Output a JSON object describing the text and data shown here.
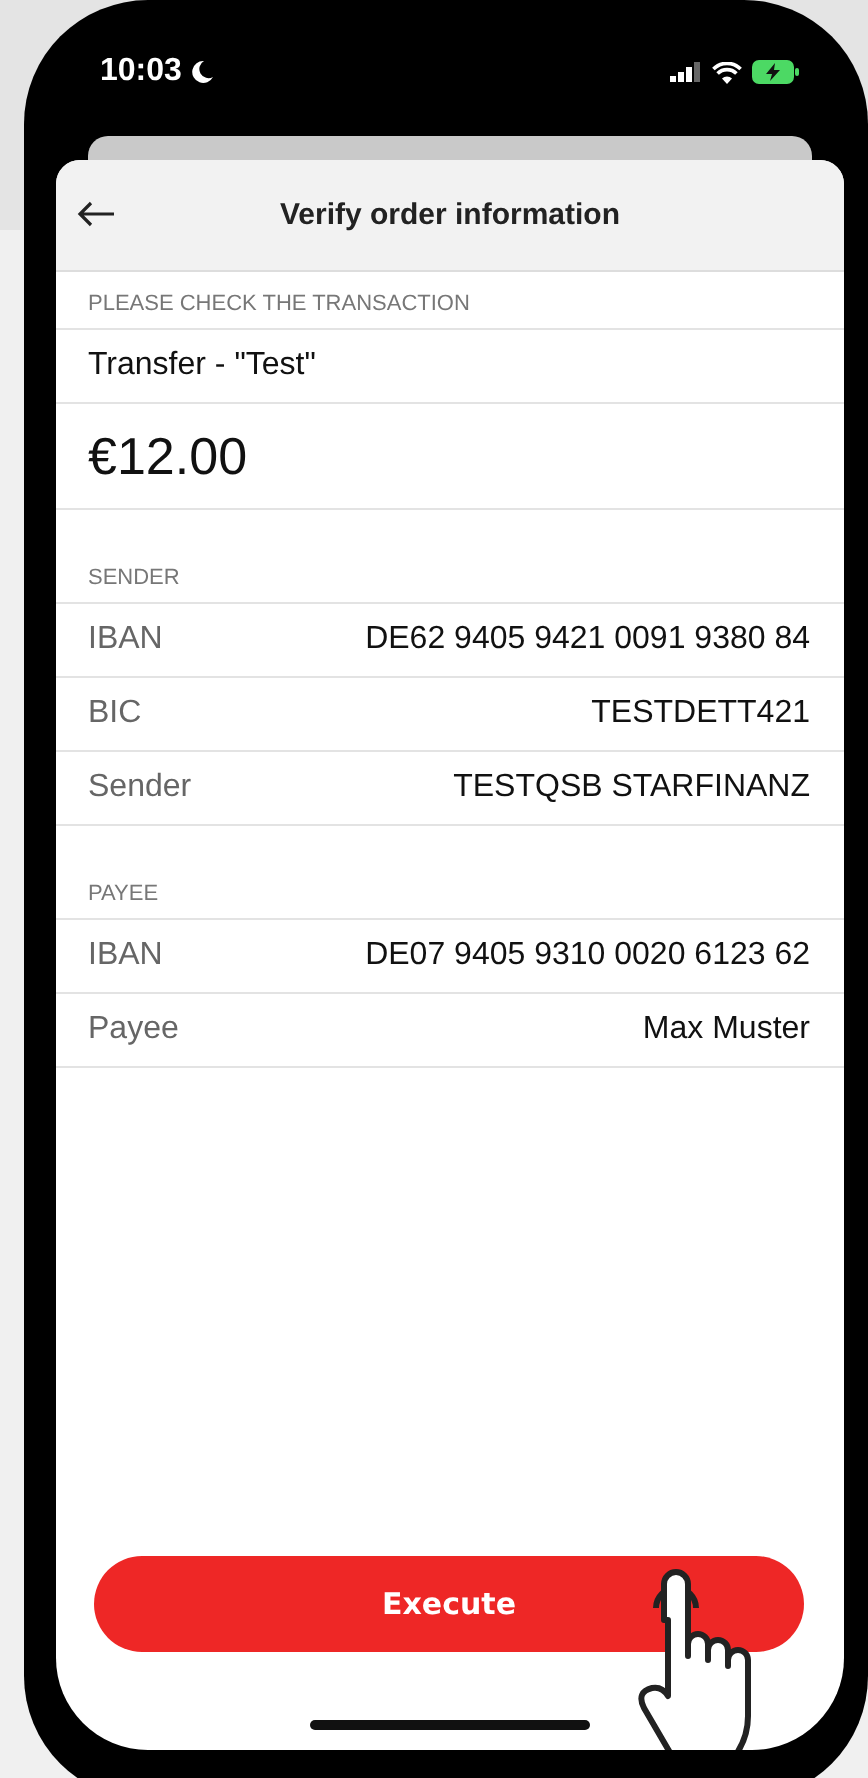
{
  "status_bar": {
    "time": "10:03"
  },
  "header": {
    "title": "Verify order information"
  },
  "transaction": {
    "heading": "PLEASE CHECK THE TRANSACTION",
    "description": "Transfer - \"Test\"",
    "amount": "€12.00"
  },
  "sections": [
    {
      "heading": "SENDER",
      "rows": [
        {
          "label": "IBAN",
          "value": "DE62 9405 9421 0091 9380 84"
        },
        {
          "label": "BIC",
          "value": "TESTDETT421"
        },
        {
          "label": "Sender",
          "value": "TESTQSB STARFINANZ"
        }
      ]
    },
    {
      "heading": "PAYEE",
      "rows": [
        {
          "label": "IBAN",
          "value": "DE07 9405 9310 0020 6123 62"
        },
        {
          "label": "Payee",
          "value": "Max Muster"
        }
      ]
    }
  ],
  "execute_button": {
    "label": "Execute"
  }
}
